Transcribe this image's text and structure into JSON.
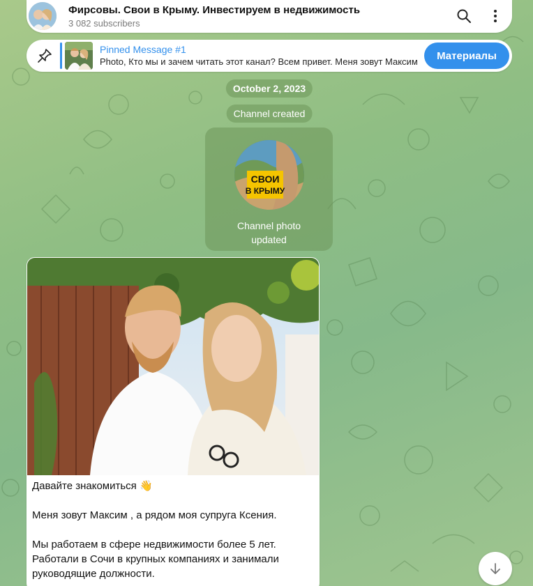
{
  "header": {
    "title": "Фирсовы. Свои в Крыму. Инвестируем в недвижимость",
    "subscribers": "3 082 subscribers"
  },
  "icons": {
    "search": "search-icon",
    "more": "more-vertical-icon",
    "pin": "pin-icon",
    "scroll_down": "arrow-down-icon"
  },
  "pinned": {
    "title": "Pinned Message #1",
    "text": "Photo, Кто мы и зачем читать этот канал? Всем привет. Меня зовут Максим",
    "button_label": "Материалы"
  },
  "service": {
    "date": "October 2, 2023",
    "created": "Channel created",
    "photo_caption_line1": "Channel photo",
    "photo_caption_line2": "updated",
    "photo_logo_line1": "СВОИ",
    "photo_logo_line2": "В КРЫМУ"
  },
  "message": {
    "line1": "Давайте знакомиться 👋",
    "line2": "Меня зовут Максим , а рядом моя супруга Ксения.",
    "line3": "Мы работаем в сфере недвижимости более 5 лет. Работали в Сочи в крупных компаниях и занимали руководящие должности."
  },
  "colors": {
    "accent": "#3390ec",
    "background": "#8fbe84",
    "service_bubble": "#7ba56b"
  }
}
